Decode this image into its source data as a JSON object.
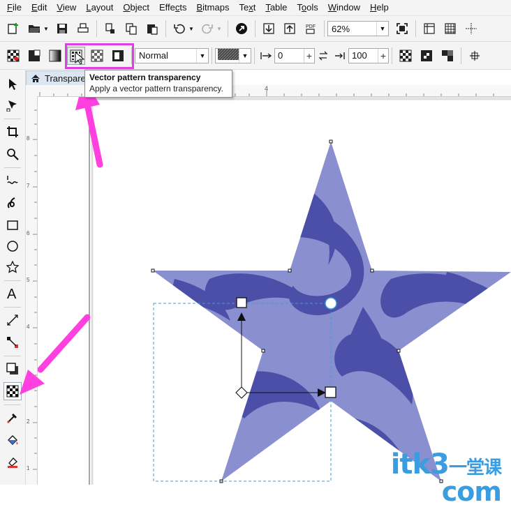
{
  "menu": [
    "File",
    "Edit",
    "View",
    "Layout",
    "Object",
    "Effects",
    "Bitmaps",
    "Text",
    "Table",
    "Tools",
    "Window",
    "Help"
  ],
  "menu_accel": [
    "F",
    "E",
    "V",
    "L",
    "O",
    "c",
    "B",
    "x",
    "T",
    "o",
    "W",
    "H"
  ],
  "toolbar1": {
    "zoom_value": "62%"
  },
  "toolbar2": {
    "merge_mode": "Normal",
    "transparency_start": "0",
    "transparency_end": "100"
  },
  "document": {
    "tab_label": "Transpare"
  },
  "tooltip": {
    "title": "Vector pattern transparency",
    "description": "Apply a vector pattern transparency."
  },
  "ruler": {
    "h_label": "4",
    "v_labels": [
      "8",
      "7",
      "6",
      "5",
      "4",
      "3",
      "2",
      "1"
    ]
  },
  "watermark": {
    "text": "itk3",
    "suffix": "com",
    "cn": "一堂课"
  },
  "colors": {
    "accent_pink": "#e040e0",
    "star_dark": "#4b4fa8",
    "star_light": "#8a8fcf",
    "selection": "#3c9ed8"
  }
}
